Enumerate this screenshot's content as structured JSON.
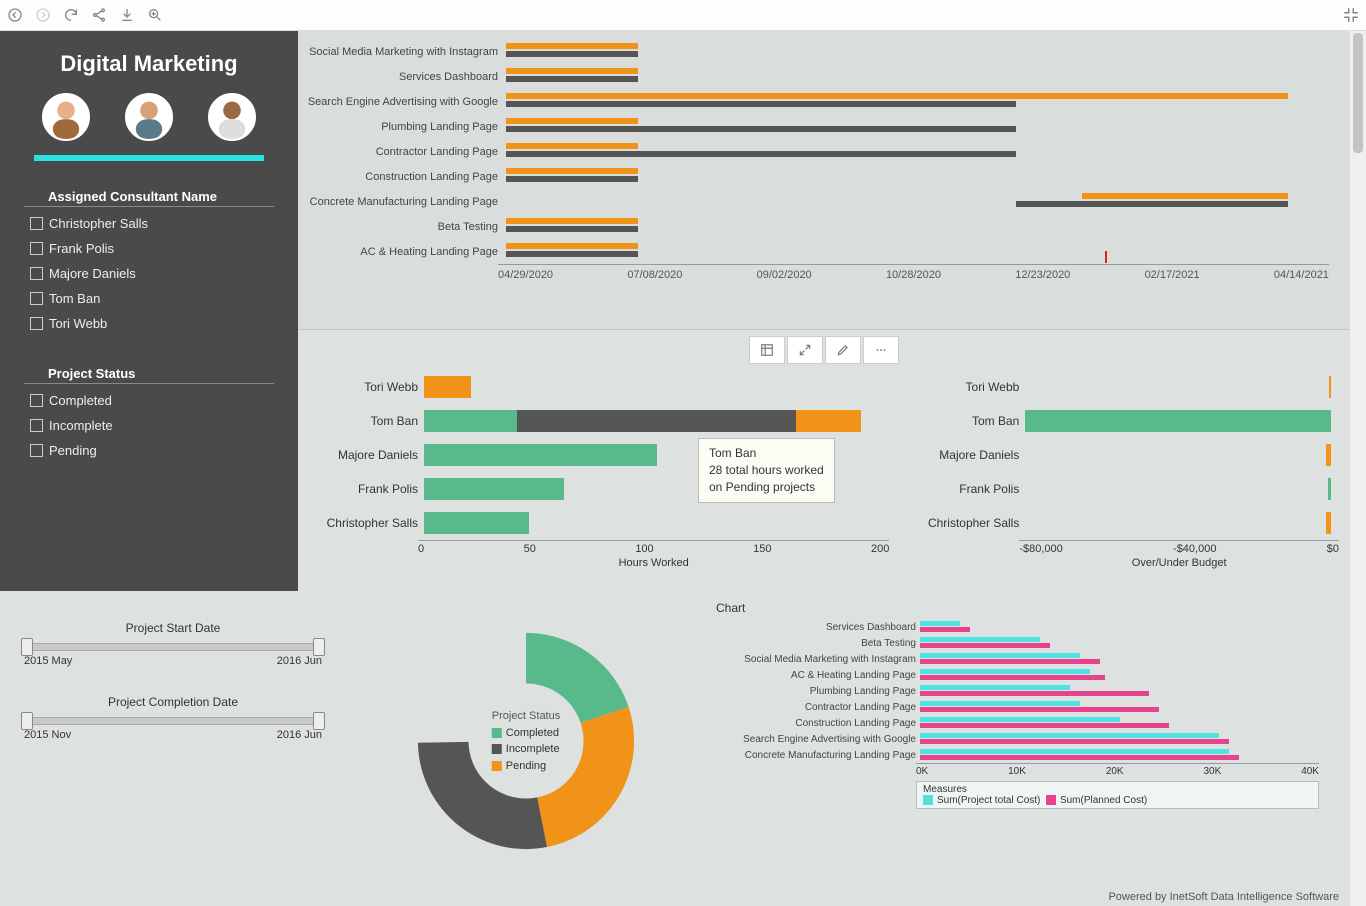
{
  "header": {
    "title": "Digital Marketing"
  },
  "filters": {
    "consultant": {
      "title": "Assigned Consultant Name",
      "items": [
        "Christopher Salls",
        "Frank Polis",
        "Majore Daniels",
        "Tom Ban",
        "Tori Webb"
      ]
    },
    "status": {
      "title": "Project Status",
      "items": [
        "Completed",
        "Incomplete",
        "Pending"
      ]
    }
  },
  "sliders": {
    "start": {
      "title": "Project Start Date",
      "min": "2015 May",
      "max": "2016 Jun"
    },
    "completion": {
      "title": "Project Completion Date",
      "min": "2015 Nov",
      "max": "2016 Jun"
    }
  },
  "tooltip": {
    "line1": "Tom Ban",
    "line2": "28 total hours worked",
    "line3": "on  Pending projects"
  },
  "donut_legend": {
    "title": "Project Status",
    "items": [
      "Completed",
      "Incomplete",
      "Pending"
    ]
  },
  "cost_chart_title": "Chart",
  "cost_legend": {
    "title": "Measures",
    "s1": "Sum(Project total   Cost)",
    "s2": "Sum(Planned Cost)"
  },
  "footer": "Powered by InetSoft Data Intelligence Software",
  "axes": {
    "gantt": [
      "04/29/2020",
      "07/08/2020",
      "09/02/2020",
      "10/28/2020",
      "12/23/2020",
      "02/17/2021",
      "04/14/2021"
    ],
    "hours": [
      "0",
      "50",
      "100",
      "150",
      "200"
    ],
    "hours_title": "Hours Worked",
    "budget": [
      "-$80,000",
      "-$40,000",
      "$0"
    ],
    "budget_title": "Over/Under Budget",
    "cost": [
      "0K",
      "10K",
      "20K",
      "30K",
      "40K"
    ]
  },
  "chart_data": [
    {
      "type": "bar",
      "orientation": "horizontal-timeline",
      "title": "Project timeline (Gantt)",
      "x_domain": [
        "04/29/2020",
        "05/20/2021"
      ],
      "categories": [
        "Social Media Marketing with Instagram",
        "Services Dashboard",
        "Search Engine Advertising with Google",
        "Plumbing Landing Page",
        "Contractor Landing Page",
        "Construction Landing Page",
        "Concrete Manufacturing Landing Page",
        "Beta Testing",
        "AC & Heating Landing Page"
      ],
      "bars": [
        {
          "project": "Social Media Marketing with Instagram",
          "segments": [
            {
              "color": "orange",
              "start": 0,
              "end": 16
            },
            {
              "color": "gray",
              "start": 0,
              "end": 16
            }
          ]
        },
        {
          "project": "Services Dashboard",
          "segments": [
            {
              "color": "orange",
              "start": 0,
              "end": 16
            },
            {
              "color": "gray",
              "start": 0,
              "end": 16
            }
          ]
        },
        {
          "project": "Search Engine Advertising with Google",
          "segments": [
            {
              "color": "orange",
              "start": 0,
              "end": 16
            },
            {
              "color": "gray",
              "start": 0,
              "end": 16
            },
            {
              "color": "orange",
              "start": 16,
              "end": 95
            },
            {
              "color": "gray",
              "start": 16,
              "end": 62
            }
          ]
        },
        {
          "project": "Plumbing Landing Page",
          "segments": [
            {
              "color": "orange",
              "start": 0,
              "end": 16
            },
            {
              "color": "gray",
              "start": 0,
              "end": 62
            }
          ]
        },
        {
          "project": "Contractor Landing Page",
          "segments": [
            {
              "color": "orange",
              "start": 0,
              "end": 16
            },
            {
              "color": "gray",
              "start": 0,
              "end": 62
            }
          ]
        },
        {
          "project": "Construction Landing Page",
          "segments": [
            {
              "color": "orange",
              "start": 0,
              "end": 16
            },
            {
              "color": "gray",
              "start": 0,
              "end": 16
            }
          ]
        },
        {
          "project": "Concrete Manufacturing Landing Page",
          "segments": [
            {
              "color": "orange",
              "start": 70,
              "end": 95
            },
            {
              "color": "gray",
              "start": 62,
              "end": 95
            }
          ]
        },
        {
          "project": "Beta Testing",
          "segments": [
            {
              "color": "orange",
              "start": 0,
              "end": 16
            },
            {
              "color": "gray",
              "start": 0,
              "end": 16
            }
          ]
        },
        {
          "project": "AC & Heating Landing Page",
          "segments": [
            {
              "color": "orange",
              "start": 0,
              "end": 16
            },
            {
              "color": "gray",
              "start": 0,
              "end": 16
            }
          ]
        }
      ],
      "marker_percent": 73
    },
    {
      "type": "bar",
      "orientation": "horizontal-stacked",
      "xlabel": "Hours Worked",
      "xlim": [
        0,
        200
      ],
      "categories": [
        "Tori Webb",
        "Tom Ban",
        "Majore Daniels",
        "Frank Polis",
        "Christopher Salls"
      ],
      "series_colors": {
        "Completed": "#58b98a",
        "Incomplete": "#555555",
        "Pending": "#f09318"
      },
      "data": [
        {
          "name": "Tori Webb",
          "Completed": 0,
          "Incomplete": 0,
          "Pending": 20
        },
        {
          "name": "Tom Ban",
          "Completed": 40,
          "Incomplete": 120,
          "Pending": 28
        },
        {
          "name": "Majore Daniels",
          "Completed": 100,
          "Incomplete": 0,
          "Pending": 0
        },
        {
          "name": "Frank Polis",
          "Completed": 60,
          "Incomplete": 0,
          "Pending": 0
        },
        {
          "name": "Christopher Salls",
          "Completed": 45,
          "Incomplete": 0,
          "Pending": 0
        }
      ]
    },
    {
      "type": "bar",
      "orientation": "horizontal",
      "xlabel": "Over/Under Budget",
      "xlim": [
        -80000,
        2000
      ],
      "categories": [
        "Tori Webb",
        "Tom Ban",
        "Majore Daniels",
        "Frank Polis",
        "Christopher Salls"
      ],
      "values": [
        -500,
        -80000,
        -1500,
        -800,
        -1500
      ],
      "colors": [
        "#f09318",
        "#58b98a",
        "#f09318",
        "#58b98a",
        "#f09318"
      ]
    },
    {
      "type": "pie",
      "title": "Project Status",
      "labels": [
        "Completed",
        "Incomplete",
        "Pending"
      ],
      "values": [
        45,
        28,
        27
      ],
      "colors": [
        "#58b98a",
        "#555555",
        "#f09318"
      ]
    },
    {
      "type": "bar",
      "orientation": "horizontal-grouped",
      "title": "Chart",
      "xlim": [
        0,
        40000
      ],
      "categories": [
        "Services Dashboard",
        "Beta Testing",
        "Social Media Marketing with Instagram",
        "AC & Heating Landing Page",
        "Plumbing Landing Page",
        "Contractor Landing Page",
        "Construction Landing Page",
        "Search Engine Advertising with Google",
        "Concrete Manufacturing Landing Page"
      ],
      "series": [
        {
          "name": "Sum(Project total Cost)",
          "color": "#4de3e3",
          "values": [
            4000,
            12000,
            16000,
            17000,
            15000,
            16000,
            20000,
            30000,
            31000
          ]
        },
        {
          "name": "Sum(Planned Cost)",
          "color": "#e6448f",
          "values": [
            5000,
            13000,
            18000,
            18500,
            23000,
            24000,
            25000,
            31000,
            32000
          ]
        }
      ]
    }
  ]
}
